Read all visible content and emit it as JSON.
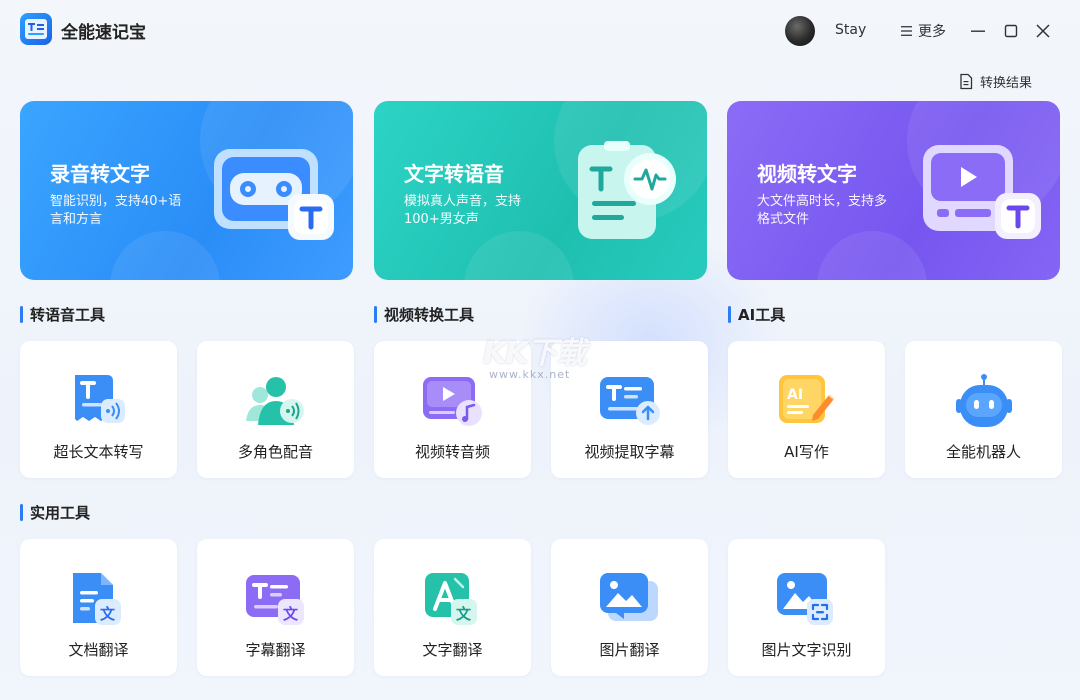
{
  "app": {
    "title": "全能速记宝"
  },
  "header": {
    "username": "Stay",
    "more_label": "更多",
    "results_label": "转换结果"
  },
  "heroes": [
    {
      "title": "录音转文字",
      "desc": "智能识别，支持40+语言和方言",
      "color": "#2a8df7"
    },
    {
      "title": "文字转语音",
      "desc": "模拟真人声音，支持100+男女声",
      "color": "#1fbfb0"
    },
    {
      "title": "视频转文字",
      "desc": "大文件高时长，支持多格式文件",
      "color": "#7656ef"
    }
  ],
  "sections": {
    "voice_tools": "转语音工具",
    "video_tools": "视频转换工具",
    "ai_tools": "AI工具",
    "utility_tools": "实用工具"
  },
  "tools": [
    {
      "label": "超长文本转写",
      "icon": "long-text-transcribe-icon"
    },
    {
      "label": "多角色配音",
      "icon": "multi-role-dubbing-icon"
    },
    {
      "label": "视频转音频",
      "icon": "video-to-audio-icon"
    },
    {
      "label": "视频提取字幕",
      "icon": "video-subtitle-extract-icon"
    },
    {
      "label": "AI写作",
      "icon": "ai-writing-icon"
    },
    {
      "label": "全能机器人",
      "icon": "robot-icon"
    },
    {
      "label": "文档翻译",
      "icon": "document-translate-icon"
    },
    {
      "label": "字幕翻译",
      "icon": "subtitle-translate-icon"
    },
    {
      "label": "文字翻译",
      "icon": "text-translate-icon"
    },
    {
      "label": "图片翻译",
      "icon": "image-translate-icon"
    },
    {
      "label": "图片文字识别",
      "icon": "image-ocr-icon"
    }
  ],
  "watermark": {
    "brand": "KK下载",
    "url": "www.kkx.net"
  }
}
